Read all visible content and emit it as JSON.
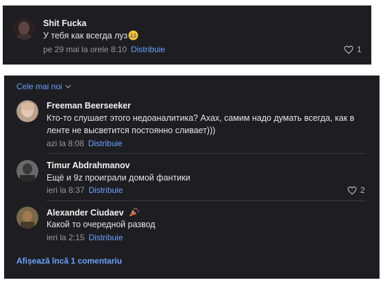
{
  "top_comment": {
    "author": "Shit Fucka",
    "text": "У тебя как всегда луз",
    "time": "pe 29 mai la orele 8:10",
    "share_label": "Distribuie",
    "likes": "1"
  },
  "comments_section": {
    "sort_label": "Cele mai noi",
    "comments": [
      {
        "author": "Freeman Beerseeker",
        "text": "Кто-то слушает этого недоаналитика? Ахах, самим надо думать всегда, как в ленте не высветится постоянно сливает)))",
        "time": "azi la 8:08",
        "share_label": "Distribuie"
      },
      {
        "author": "Timur Abdrahmanov",
        "text": "Ещё и 9z проиграли домой фантики",
        "time": "ieri la 8:37",
        "share_label": "Distribuie",
        "likes": "2"
      },
      {
        "author": "Alexander Ciudaev",
        "text": "Какой то очередной развод",
        "time": "ieri la 2:15",
        "share_label": "Distribuie"
      }
    ],
    "show_more_label": "Afișează încă 1 comentariu"
  },
  "colors": {
    "background": "#1e1e22",
    "link": "#6aa2ff",
    "muted": "#9a9a9a"
  }
}
